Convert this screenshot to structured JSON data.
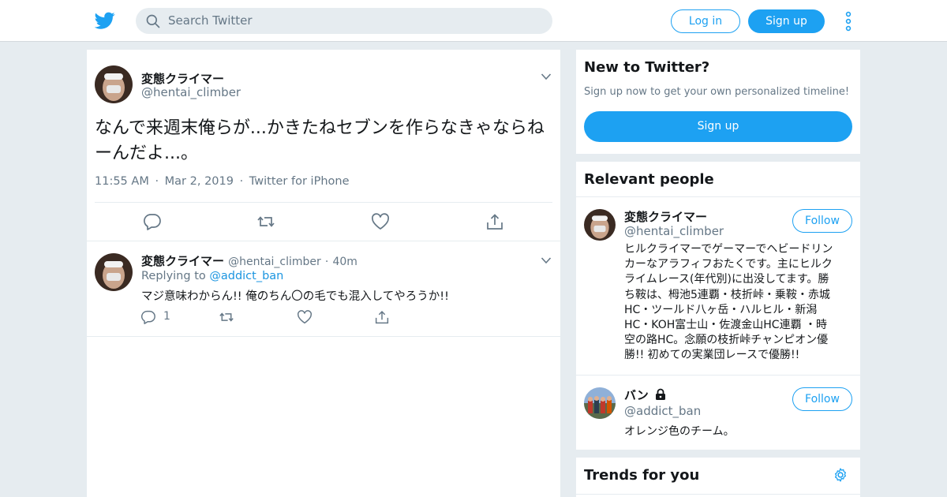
{
  "header": {
    "search_placeholder": "Search Twitter",
    "login_label": "Log in",
    "signup_label": "Sign up"
  },
  "tweet": {
    "author_name": "変態クライマー",
    "author_handle": "@hentai_climber",
    "text": "なんで来週末俺らが...かきたねセブンを作らなきゃならねーんだよ...。",
    "time": "11:55 AM",
    "date": "Mar 2, 2019",
    "source": "Twitter for iPhone",
    "sep": "·"
  },
  "reply": {
    "author_name": "変態クライマー",
    "author_handle": "@hentai_climber",
    "sep": "·",
    "age": "40m",
    "replying_to_label": "Replying to",
    "replying_to_handle": "@addict_ban",
    "text": "マジ意味わからん!! 俺のちん〇の毛でも混入してやろうか!!",
    "reply_count": "1"
  },
  "new_to_twitter": {
    "title": "New to Twitter?",
    "subtitle": "Sign up now to get your own personalized timeline!",
    "button": "Sign up"
  },
  "relevant_people": {
    "title": "Relevant people",
    "people": [
      {
        "name": "変態クライマー",
        "handle": "@hentai_climber",
        "follow": "Follow",
        "bio_lines": [
          "ヒルクライマーでゲーマーでヘビードリン",
          "カーなアラフィフおたくです。主にヒルク",
          "ライムレース(年代別)に出没してます。勝",
          "ち鞍は、栂池5連覇・枝折峠・乗鞍・赤城",
          "HC・ツールド八ヶ岳・ハルヒル・新潟",
          "HC・KOH富士山・佐渡金山HC連覇 ・時",
          "空の路HC。念願の枝折峠チャンピオン優",
          "勝!! 初めての実業団レースで優勝!!"
        ]
      },
      {
        "name": "バン",
        "handle": "@addict_ban",
        "follow": "Follow",
        "bio": "オレンジ色のチーム。"
      }
    ]
  },
  "trends": {
    "title": "Trends for you"
  },
  "colors": {
    "accent": "#1da1f2",
    "link": "#1b95e0",
    "secondary_text": "#657786",
    "background": "#e6ecf0"
  },
  "icons": [
    "twitter-bird-icon",
    "search-icon",
    "more-vertical-icon",
    "chevron-down-icon",
    "reply-icon",
    "retweet-icon",
    "like-icon",
    "share-icon",
    "lock-icon",
    "gear-icon"
  ]
}
